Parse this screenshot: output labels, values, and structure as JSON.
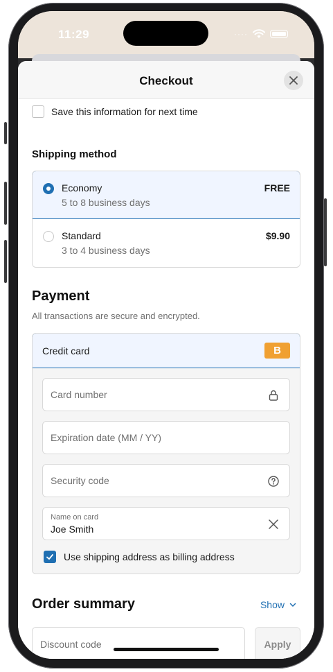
{
  "status_bar": {
    "time": "11:29"
  },
  "sheet": {
    "title": "Checkout"
  },
  "save_info": {
    "label": "Save this information for next time",
    "checked": false
  },
  "shipping": {
    "heading": "Shipping method",
    "options": [
      {
        "name": "Economy",
        "detail": "5 to 8 business days",
        "price": "FREE",
        "selected": true
      },
      {
        "name": "Standard",
        "detail": "3 to 4 business days",
        "price": "$9.90",
        "selected": false
      }
    ]
  },
  "payment": {
    "heading": "Payment",
    "subtext": "All transactions are secure and encrypted.",
    "method_label": "Credit card",
    "brand_badge": "B",
    "fields": {
      "card_number": {
        "placeholder": "Card number",
        "icon": "lock-icon"
      },
      "expiration": {
        "placeholder": "Expiration date (MM / YY)"
      },
      "security_code": {
        "placeholder": "Security code",
        "icon": "help-circle-icon"
      },
      "name_on_card": {
        "label": "Name on card",
        "value": "Joe Smith",
        "icon": "clear-icon"
      }
    },
    "billing_same": {
      "label": "Use shipping address as billing address",
      "checked": true
    }
  },
  "order_summary": {
    "heading": "Order summary",
    "toggle_label": "Show",
    "discount_placeholder": "Discount code",
    "apply_label": "Apply"
  },
  "colors": {
    "accent": "#1f6fb2",
    "selected_bg": "#f0f5ff",
    "brand_badge": "#f0a032",
    "status_bar_bg": "#ede4da"
  }
}
